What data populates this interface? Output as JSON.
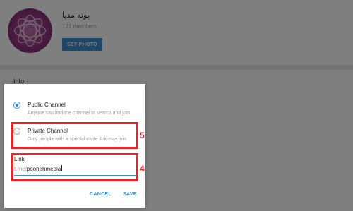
{
  "group": {
    "title": "پونه مدیا",
    "members": "121 members",
    "set_photo_label": "SET PHOTO"
  },
  "info_label": "Info",
  "dialog": {
    "options": [
      {
        "title": "Public Channel",
        "description": "Anyone can find the channel in search and join",
        "selected": true
      },
      {
        "title": "Private Channel",
        "description": "Only people with a special invite link may join",
        "selected": false
      }
    ],
    "link": {
      "label": "Link",
      "prefix": "t.me/",
      "value": "poonehmedia"
    },
    "cancel_label": "CANCEL",
    "save_label": "SAVE"
  },
  "annotations": {
    "private_channel_marker": "5",
    "link_marker": "4"
  },
  "colors": {
    "accent": "#3a8fd2",
    "annotation": "#e8252b",
    "overlay": "rgba(0,0,0,0.5)"
  }
}
